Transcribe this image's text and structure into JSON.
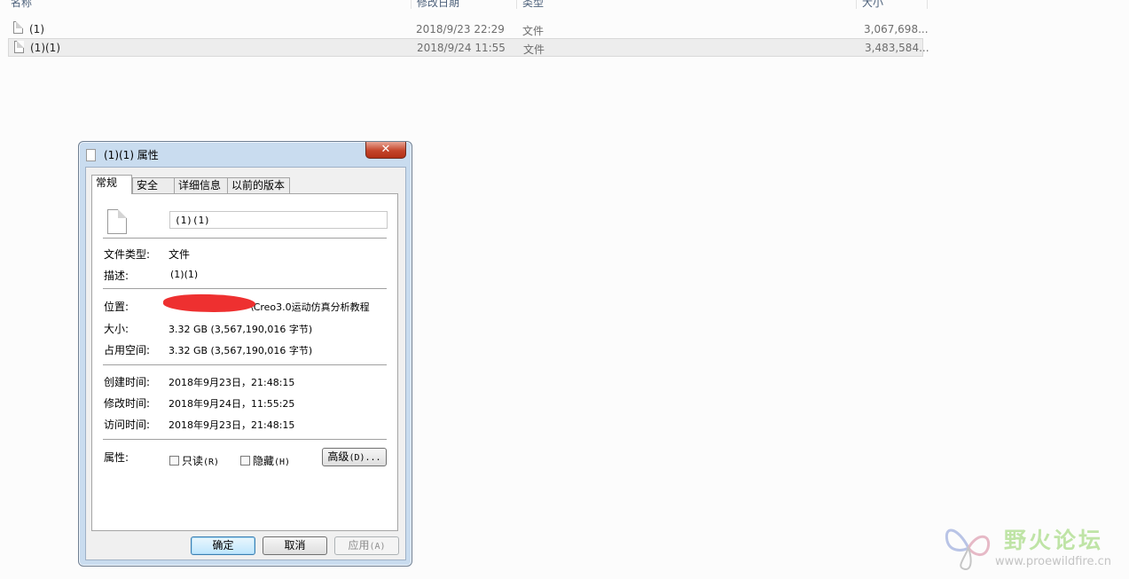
{
  "explorer": {
    "columns": {
      "name": "名称",
      "modified": "修改日期",
      "type": "类型",
      "size": "大小"
    },
    "files": [
      {
        "name": "(1)",
        "modified": "2018/9/23 22:29",
        "type": "文件",
        "size": "3,067,698..."
      },
      {
        "name": "(1)(1)",
        "modified": "2018/9/24 11:55",
        "type": "文件",
        "size": "3,483,584..."
      }
    ]
  },
  "dialog": {
    "title": "(1)(1) 属性",
    "close_glyph": "✕",
    "tabs": [
      "常规",
      "安全",
      "详细信息",
      "以前的版本"
    ],
    "file_name_value": "(1)(1)",
    "file_type_label": "文件类型:",
    "file_type_value": "文件",
    "description_label": "描述:",
    "description_value": "(1)(1)",
    "location_label": "位置:",
    "location_value": "\\Creo3.0运动仿真分析教程",
    "size_label": "大小:",
    "size_value": "3.32 GB (3,567,190,016 字节)",
    "size_on_disk_label": "占用空间:",
    "size_on_disk_value": "3.32 GB (3,567,190,016 字节)",
    "created_label": "创建时间:",
    "created_value": "2018年9月23日，21:48:15",
    "modified_label": "修改时间:",
    "modified_value": "2018年9月24日，11:55:25",
    "accessed_label": "访问时间:",
    "accessed_value": "2018年9月23日，21:48:15",
    "attributes_label": "属性:",
    "readonly_label": "只读",
    "readonly_key": "(R)",
    "hidden_label": "隐藏",
    "hidden_key": "(H)",
    "advanced_label": "高级",
    "advanced_key": "(D)...",
    "ok_label": "确定",
    "cancel_label": "取消",
    "apply_label": "应用",
    "apply_key": "(A)"
  },
  "watermark": {
    "title": "野火论坛",
    "url": "www.proewildfire.cn"
  },
  "colors": {
    "selection_bg": "#ededed",
    "dialog_frame": "#c9dcef",
    "close_button": "#c4442a",
    "redaction": "#ee3030",
    "watermark_green": "#bfe4a6"
  }
}
